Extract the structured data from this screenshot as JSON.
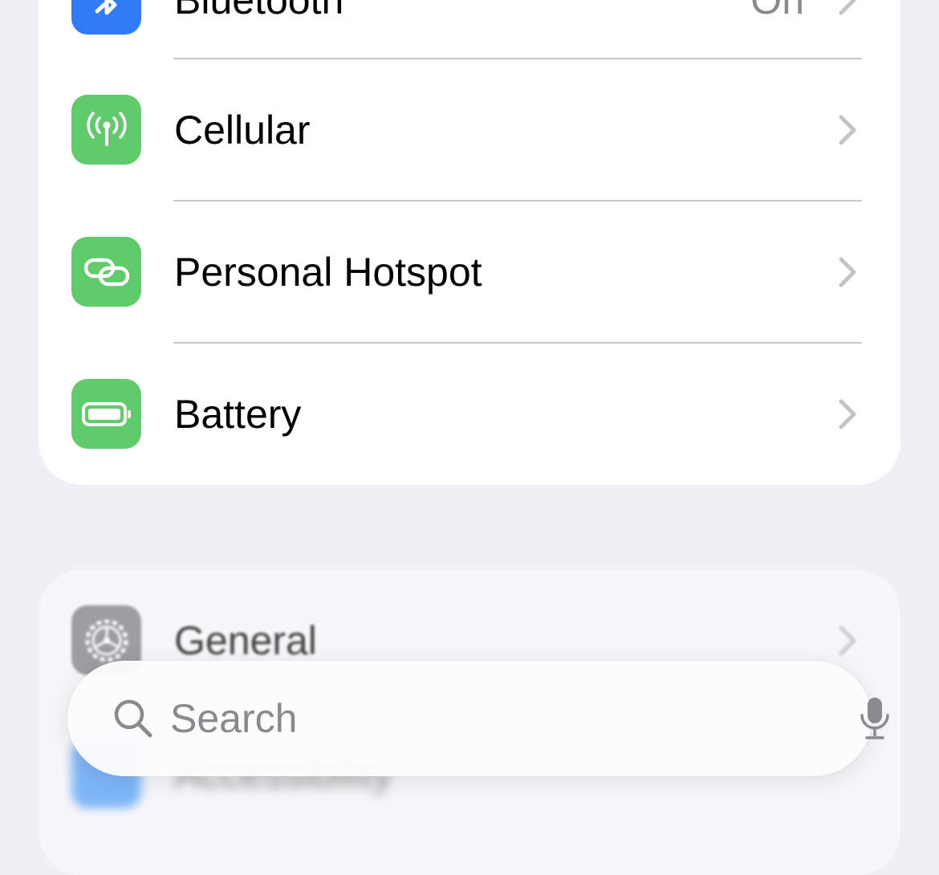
{
  "settings": {
    "connectivity_group": [
      {
        "label": "Bluetooth",
        "value": "On",
        "icon": "bluetooth-icon",
        "color": "#2f7cf6"
      },
      {
        "label": "Cellular",
        "value": "",
        "icon": "antenna-icon",
        "color": "#5fcb6a"
      },
      {
        "label": "Personal Hotspot",
        "value": "",
        "icon": "link-icon",
        "color": "#5fcb6a"
      },
      {
        "label": "Battery",
        "value": "",
        "icon": "battery-icon",
        "color": "#5fcb6a"
      }
    ],
    "system_group": [
      {
        "label": "General",
        "icon": "gear-icon",
        "color": "#8e8e93"
      },
      {
        "label": "Accessibility",
        "icon": "accessibility-icon",
        "color": "#2f8cf8"
      }
    ]
  },
  "search": {
    "placeholder": "Search",
    "icon": "search-icon",
    "mic_icon": "microphone-icon"
  }
}
